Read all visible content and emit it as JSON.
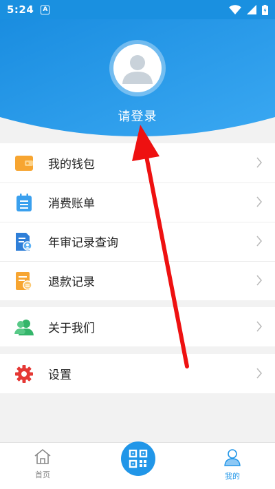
{
  "status_bar": {
    "time": "5:24",
    "badge": "A"
  },
  "profile": {
    "login_label": "请登录"
  },
  "menu_group_1": [
    {
      "label": "我的钱包",
      "icon": "wallet-icon"
    },
    {
      "label": "消费账单",
      "icon": "bill-icon"
    },
    {
      "label": "年审记录查询",
      "icon": "record-query-icon"
    },
    {
      "label": "退款记录",
      "icon": "refund-icon"
    }
  ],
  "menu_group_2": [
    {
      "label": "关于我们",
      "icon": "about-us-icon"
    }
  ],
  "menu_group_3": [
    {
      "label": "设置",
      "icon": "settings-gear-icon"
    }
  ],
  "tab_bar": {
    "home_label": "首页",
    "mine_label": "我的",
    "active_color": "#2196e8",
    "inactive_color": "#888888"
  },
  "colors": {
    "header_blue": "#1a90e0",
    "accent_red": "#ee1111"
  }
}
